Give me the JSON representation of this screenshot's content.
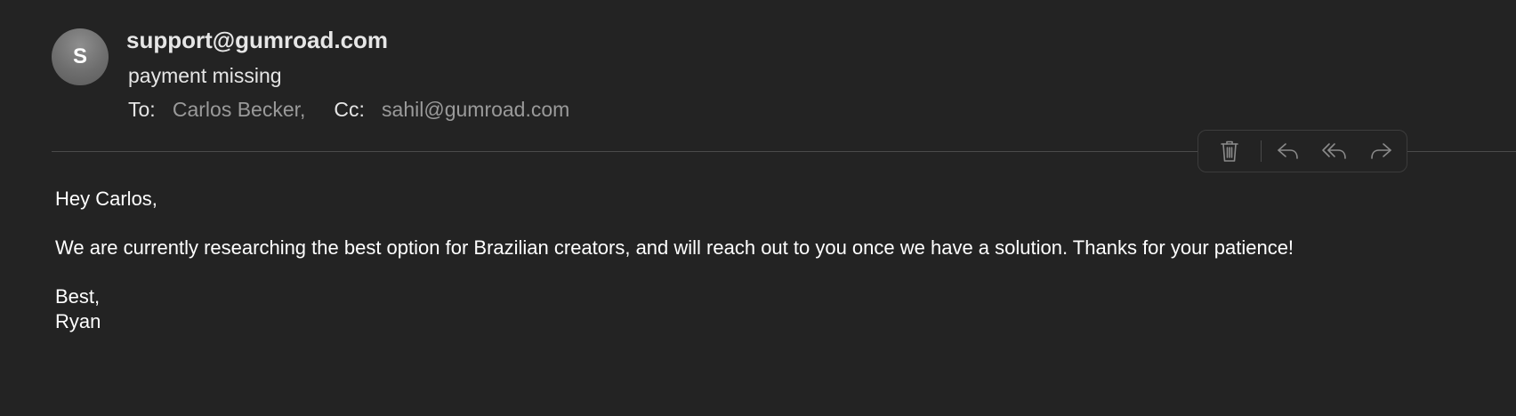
{
  "header": {
    "avatar_initial": "S",
    "sender": "support@gumroad.com",
    "subject": "payment missing",
    "to_label": "To:",
    "to_value": "Carlos Becker,",
    "cc_label": "Cc:",
    "cc_value": "sahil@gumroad.com"
  },
  "toolbar": {
    "icons": [
      "trash-icon",
      "reply-icon",
      "reply-all-icon",
      "forward-icon"
    ]
  },
  "message": {
    "greeting": "Hey Carlos,",
    "paragraph": "We are currently researching the best option for Brazilian creators, and will reach out to you once we have a solution. Thanks for your patience!",
    "closing": "Best,",
    "signature": "Ryan"
  },
  "colors": {
    "background": "#232323",
    "text": "#ffffff",
    "muted": "#9a9a9a",
    "icon": "#8a8a8a"
  }
}
